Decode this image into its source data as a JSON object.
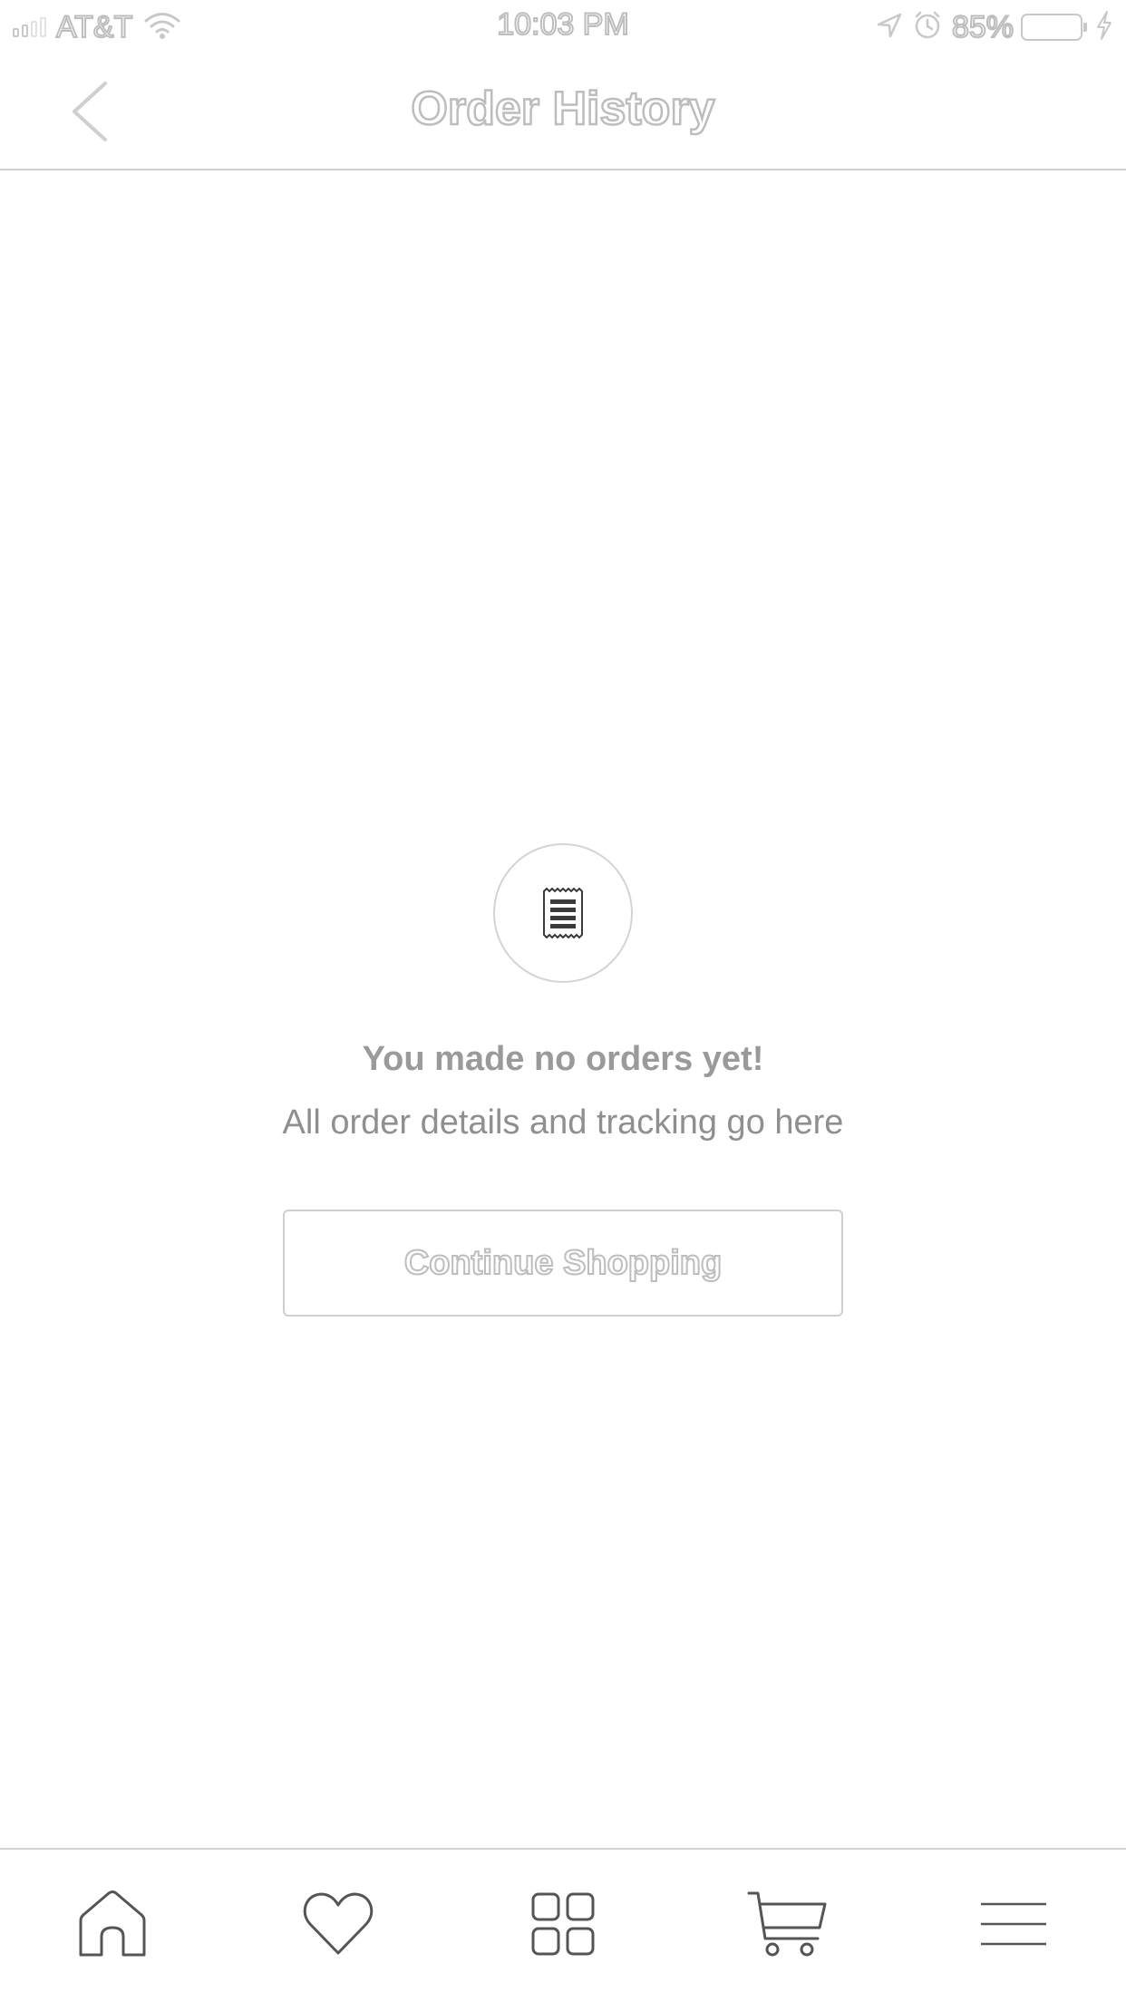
{
  "status_bar": {
    "carrier": "AT&T",
    "time": "10:03 PM",
    "battery_percent": "85%",
    "icons": [
      "signal-icon",
      "wifi-icon",
      "location-icon",
      "alarm-icon",
      "battery-icon",
      "charging-icon"
    ]
  },
  "header": {
    "title": "Order History",
    "back_icon": "chevron-left-icon"
  },
  "empty_state": {
    "icon": "receipt-icon",
    "title": "You made no orders yet!",
    "subtitle": "All order details and tracking go here",
    "button_label": "Continue Shopping"
  },
  "tab_bar": {
    "items": [
      {
        "name": "home",
        "icon": "home-icon"
      },
      {
        "name": "favorites",
        "icon": "heart-icon"
      },
      {
        "name": "categories",
        "icon": "grid-icon"
      },
      {
        "name": "cart",
        "icon": "cart-icon"
      },
      {
        "name": "menu",
        "icon": "menu-icon"
      }
    ]
  },
  "colors": {
    "background": "#ffffff",
    "text": "#8f8f8f",
    "border": "#cfcfcf",
    "icon_stroke": "#555555"
  }
}
